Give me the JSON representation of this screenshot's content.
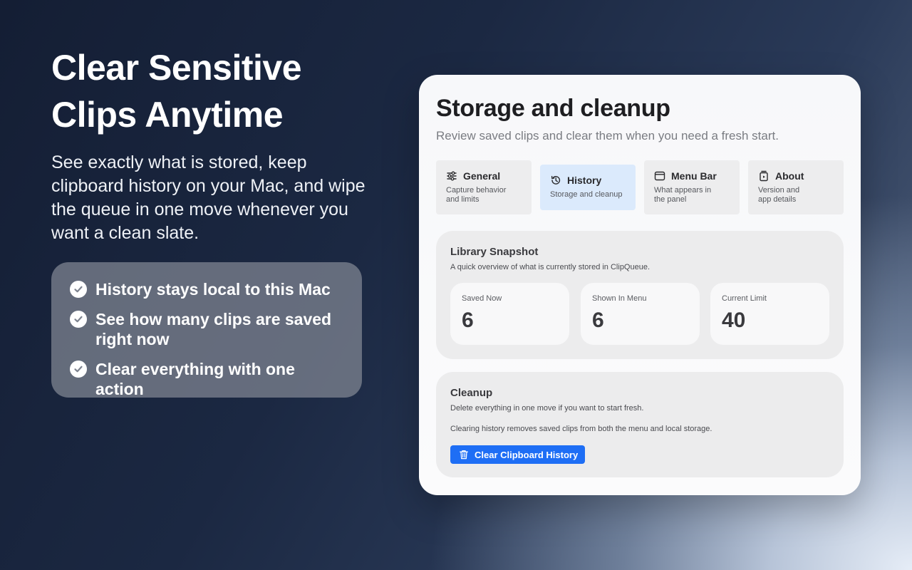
{
  "hero": {
    "headline": "Clear Sensitive Clips Anytime",
    "lede": "See exactly what is stored, keep clipboard history on your Mac, and wipe the queue in one move whenever you want a clean slate.",
    "features": [
      "History stays local to this Mac",
      "See how many clips are saved right now",
      "Clear everything with one action"
    ]
  },
  "window": {
    "title": "Storage and cleanup",
    "subtitle": "Review saved clips and clear them when you need a fresh start.",
    "tabs": [
      {
        "label": "General",
        "desc": "Capture behavior\nand limits",
        "icon": "sliders-icon"
      },
      {
        "label": "History",
        "desc": "Storage and cleanup",
        "icon": "history-icon",
        "active": true
      },
      {
        "label": "Menu Bar",
        "desc": "What appears in\nthe panel",
        "icon": "window-icon"
      },
      {
        "label": "About",
        "desc": "Version and\napp details",
        "icon": "app-info-icon"
      }
    ],
    "snapshot": {
      "title": "Library Snapshot",
      "desc": "A quick overview of what is currently stored in ClipQueue.",
      "stats": [
        {
          "label": "Saved Now",
          "value": "6"
        },
        {
          "label": "Shown In Menu",
          "value": "6"
        },
        {
          "label": "Current Limit",
          "value": "40"
        }
      ]
    },
    "cleanup": {
      "title": "Cleanup",
      "desc": "Delete everything in one move if you want to start fresh.",
      "note": "Clearing history removes saved clips from both the menu and local storage.",
      "button_label": "Clear Clipboard History"
    }
  },
  "colors": {
    "accent": "#1e6ef5",
    "active_tab": "#dbeafc"
  }
}
